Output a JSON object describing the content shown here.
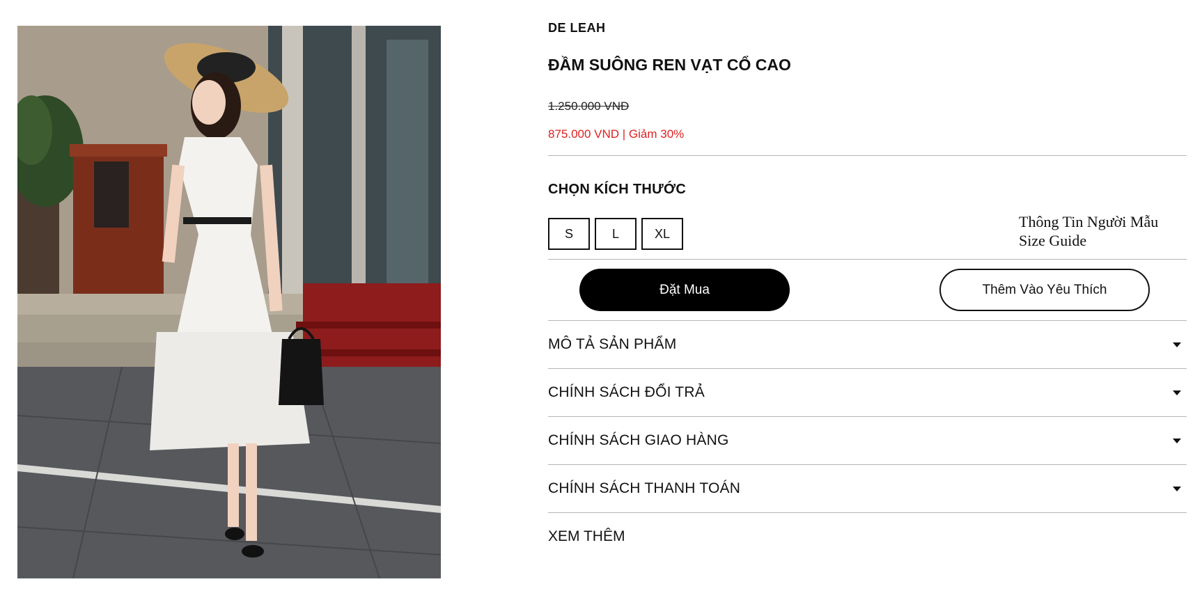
{
  "product": {
    "brand": "DE LEAH",
    "name": "ĐẦM SUÔNG REN VẠT CỔ CAO",
    "original_price": "1.250.000 VNĐ",
    "sale_price": "875.000 VND | Giảm 30%",
    "image_alt": "Model wearing white lace midi dress with straw hat and black handbag"
  },
  "sizes": {
    "heading": "CHỌN KÍCH THƯỚC",
    "options": [
      "S",
      "L",
      "XL"
    ],
    "model_info_link": "Thông Tin Người Mẫu",
    "size_guide_link": "Size Guide"
  },
  "actions": {
    "buy_label": "Đặt Mua",
    "favorite_label": "Thêm Vào Yêu Thích"
  },
  "accordion": [
    {
      "label": "MÔ TẢ SẢN PHẨM",
      "icon": "caret-down-icon"
    },
    {
      "label": "CHÍNH SÁCH ĐỔI TRẢ",
      "icon": "caret-down-icon"
    },
    {
      "label": "CHÍNH SÁCH GIAO HÀNG",
      "icon": "caret-down-icon"
    },
    {
      "label": "CHÍNH SÁCH THANH TOÁN",
      "icon": "caret-down-icon"
    }
  ],
  "see_more_label": "XEM THÊM",
  "colors": {
    "sale_price": "#e02020",
    "primary_button": "#000000",
    "divider": "#b5b5b5"
  }
}
